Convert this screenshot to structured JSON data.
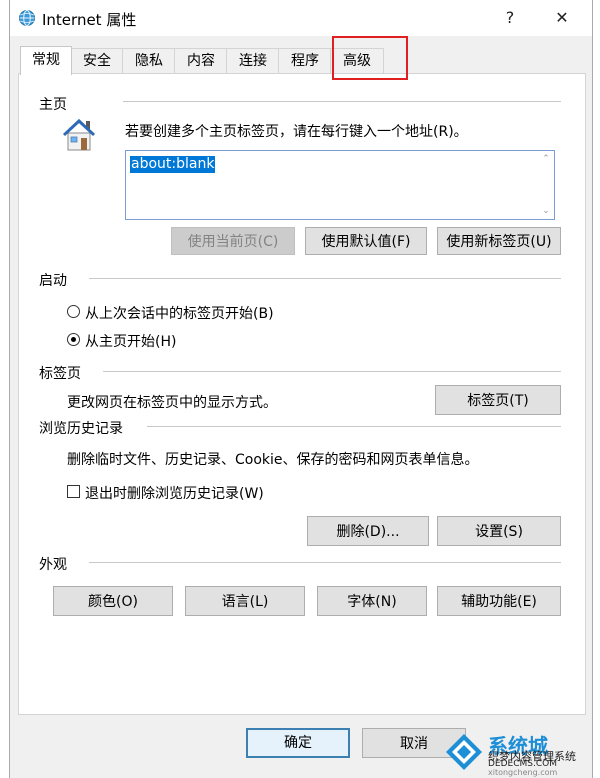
{
  "window": {
    "title": "Internet 属性",
    "help_label": "?",
    "close_label": "✕",
    "icon": "ie-globe-icon"
  },
  "tabs": [
    {
      "label": "常规",
      "active": true
    },
    {
      "label": "安全"
    },
    {
      "label": "隐私"
    },
    {
      "label": "内容"
    },
    {
      "label": "连接"
    },
    {
      "label": "程序"
    },
    {
      "label": "高级",
      "highlighted": true
    }
  ],
  "homepage": {
    "section_label": "主页",
    "icon": "house-icon",
    "description": "若要创建多个主页标签页，请在每行键入一个地址(R)。",
    "value": "about:blank",
    "btn_current": "使用当前页(C)",
    "btn_default": "使用默认值(F)",
    "btn_newtab": "使用新标签页(U)"
  },
  "startup": {
    "section_label": "启动",
    "option_last_session": "从上次会话中的标签页开始(B)",
    "option_homepage": "从主页开始(H)",
    "selected": "homepage"
  },
  "tabs_section": {
    "section_label": "标签页",
    "description": "更改网页在标签页中的显示方式。",
    "btn_tabs": "标签页(T)"
  },
  "history": {
    "section_label": "浏览历史记录",
    "description": "删除临时文件、历史记录、Cookie、保存的密码和网页表单信息。",
    "checkbox_delete_on_exit": "退出时删除浏览历史记录(W)",
    "checked": false,
    "btn_delete": "删除(D)...",
    "btn_settings": "设置(S)"
  },
  "appearance": {
    "section_label": "外观",
    "btn_colors": "颜色(O)",
    "btn_languages": "语言(L)",
    "btn_fonts": "字体(N)",
    "btn_accessibility": "辅助功能(E)"
  },
  "footer": {
    "ok_label": "确定",
    "cancel_label": "取消"
  },
  "watermark": {
    "line1": "系统城",
    "line2": "织梦内容管理系统",
    "line3": "DEDECMS.COM",
    "line4": "xitongcheng.com"
  },
  "colors": {
    "accent": "#0078d7",
    "highlight_box": "#e02020"
  }
}
